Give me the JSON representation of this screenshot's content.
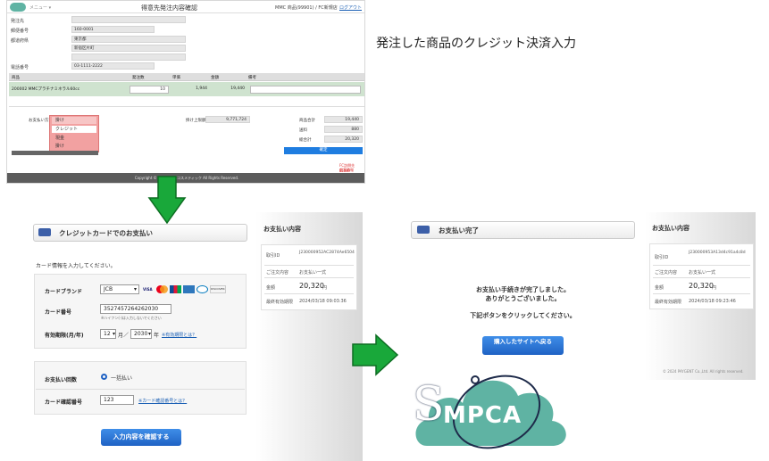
{
  "screen1": {
    "menu_label": "メニュー ▾",
    "title": "得意先発注内容確認",
    "user": "MMC 商品(99901) / FC新規店",
    "logout": "ログアウト",
    "fields": [
      {
        "label": "発注先",
        "value": ""
      },
      {
        "label": "郵便番号",
        "value": "160-0001"
      },
      {
        "label": "都道府県",
        "value": "東京都"
      },
      {
        "label": "",
        "value": "新宿区片町"
      },
      {
        "label": "",
        "value": ""
      },
      {
        "label": "電話番号",
        "value": "03-1111-2222"
      }
    ],
    "table_headers": [
      "商品",
      "発注数",
      "単価",
      "金額",
      "備考"
    ],
    "row": {
      "product": "200002 MMCプラチナミネラル60cc",
      "qty": "10",
      "unit_price": "1,944",
      "amount": "19,440",
      "note": ""
    },
    "payment_label": "お支払い方法",
    "payment_selected": "掛け",
    "payment_options": [
      "クレジット",
      "現金",
      "掛け"
    ],
    "credit_limit_label": "掛け上限額",
    "credit_limit_value": "9,771,724",
    "summary": [
      {
        "label": "商品合計",
        "value": "19,440"
      },
      {
        "label": "送料",
        "value": "880"
      },
      {
        "label": "総合計",
        "value": "20,320"
      }
    ],
    "confirm_label": "確定",
    "links": [
      "FC訪問先ELINO",
      "顧客情報ELINO"
    ],
    "copyright": "Copyright © 2024 MMCコスメティック All Rights Reserved."
  },
  "caption": "発注した商品のクレジット決済入力",
  "screen2": {
    "header": "クレジットカードでのお支払い",
    "instruction": "カード情報を入力してください。",
    "brand_label": "カードブランド",
    "brand_value": "JCB",
    "brand_logos": [
      "VISA",
      "MC",
      "JCB",
      "AMEX",
      "DC",
      "DISCOVER"
    ],
    "number_label": "カード番号",
    "number_value": "3527457264262030",
    "number_note": "※ハイフン(-)は入力しないでください",
    "expiry_label": "有効期限(月/年)",
    "expiry_month": "12",
    "expiry_year": "2030",
    "expiry_month_suffix": "月／",
    "expiry_year_suffix": "年",
    "expiry_help": "※有効期限とは？",
    "method_label": "お支払い回数",
    "method_value": "一括払い",
    "cvv_label": "カード確認番号",
    "cvv_value": "123",
    "cvv_help": "※カード確認番号とは？",
    "confirm_button": "入力内容を確認する"
  },
  "summary_left": {
    "title": "お支払い内容",
    "rows": [
      {
        "label": "取引ID",
        "value": "J230000952AC2874Ae6504"
      },
      {
        "label": "ご注文内容",
        "value": "お支払い一式"
      },
      {
        "label": "金額",
        "value": "20,320",
        "unit": "円"
      },
      {
        "label": "最終有効期限",
        "value": "2024/03/18 09:03:36"
      }
    ]
  },
  "screen3": {
    "header": "お支払い完了",
    "message1": "お支払い手続きが完了しました。",
    "message2": "ありがとうございました。",
    "message3": "下記ボタンをクリックしてください。",
    "return_button": "購入したサイトへ戻る"
  },
  "summary_right": {
    "title": "お支払い内容",
    "rows": [
      {
        "label": "取引ID",
        "value": "J230000953A13d4c91a4c8d"
      },
      {
        "label": "ご注文内容",
        "value": "お支払い一式"
      },
      {
        "label": "金額",
        "value": "20,320",
        "unit": "円"
      },
      {
        "label": "最終有効期限",
        "value": "2024/03/18 09:23:46"
      }
    ],
    "copyright": "© 2024 PAYGENT Co.,Ltd. All rights reserved."
  },
  "logo_text": "MPCA",
  "logo_initial": "S",
  "colors": {
    "arrow": "#19a83a",
    "teal": "#5fb3a3",
    "blue_button": "#1f62c4",
    "dropdown": "#f2a1a1"
  }
}
